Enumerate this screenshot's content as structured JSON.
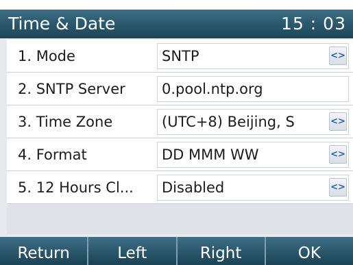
{
  "header": {
    "title": "Time & Date",
    "clock": "15 : 03"
  },
  "menu": {
    "items": [
      {
        "label": "1.  Mode",
        "value": "SNTP",
        "has_selector": true
      },
      {
        "label": "2.  SNTP Server",
        "value": "0.pool.ntp.org",
        "has_selector": false
      },
      {
        "label": "3.  Time Zone",
        "value": "(UTC+8) Beijing, S",
        "has_selector": true
      },
      {
        "label": "4.  Format",
        "value": "DD MMM WW",
        "has_selector": true
      },
      {
        "label": "5.  12 Hours Cl...",
        "value": "Disabled",
        "has_selector": true
      }
    ],
    "selector_glyph": "<>"
  },
  "softkeys": [
    "Return",
    "Left",
    "Right",
    "OK"
  ],
  "colors": {
    "title_bar": "#2c5a70",
    "softkey_bar": "#2b586d",
    "selector_arrow": "#1e64b4"
  }
}
